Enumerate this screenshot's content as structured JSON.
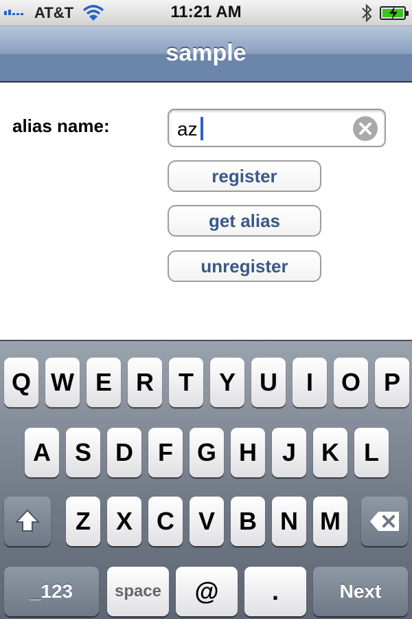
{
  "status_bar": {
    "carrier": "AT&T",
    "time": "11:21 AM",
    "icons": [
      "signal-icon",
      "wifi-icon",
      "bluetooth-icon",
      "battery-charging-icon"
    ]
  },
  "nav": {
    "title": "sample"
  },
  "form": {
    "alias_label": "alias name:",
    "alias_value": "az",
    "clear_icon": "clear-icon",
    "buttons": {
      "register": "register",
      "get_alias": "get alias",
      "unregister": "unregister"
    }
  },
  "keyboard": {
    "row1": [
      "Q",
      "W",
      "E",
      "R",
      "T",
      "Y",
      "U",
      "I",
      "O",
      "P"
    ],
    "row2": [
      "A",
      "S",
      "D",
      "F",
      "G",
      "H",
      "J",
      "K",
      "L"
    ],
    "row3": [
      "Z",
      "X",
      "C",
      "V",
      "B",
      "N",
      "M"
    ],
    "numbers_key": "_123",
    "space_key": "space",
    "at_key": "@",
    "dot_key": ".",
    "next_key": "Next",
    "shift_icon": "shift-icon",
    "delete_icon": "backspace-icon"
  },
  "colors": {
    "accent_text": "#3b5887",
    "caret": "#2f5fd1",
    "battery": "#3ec21f"
  }
}
